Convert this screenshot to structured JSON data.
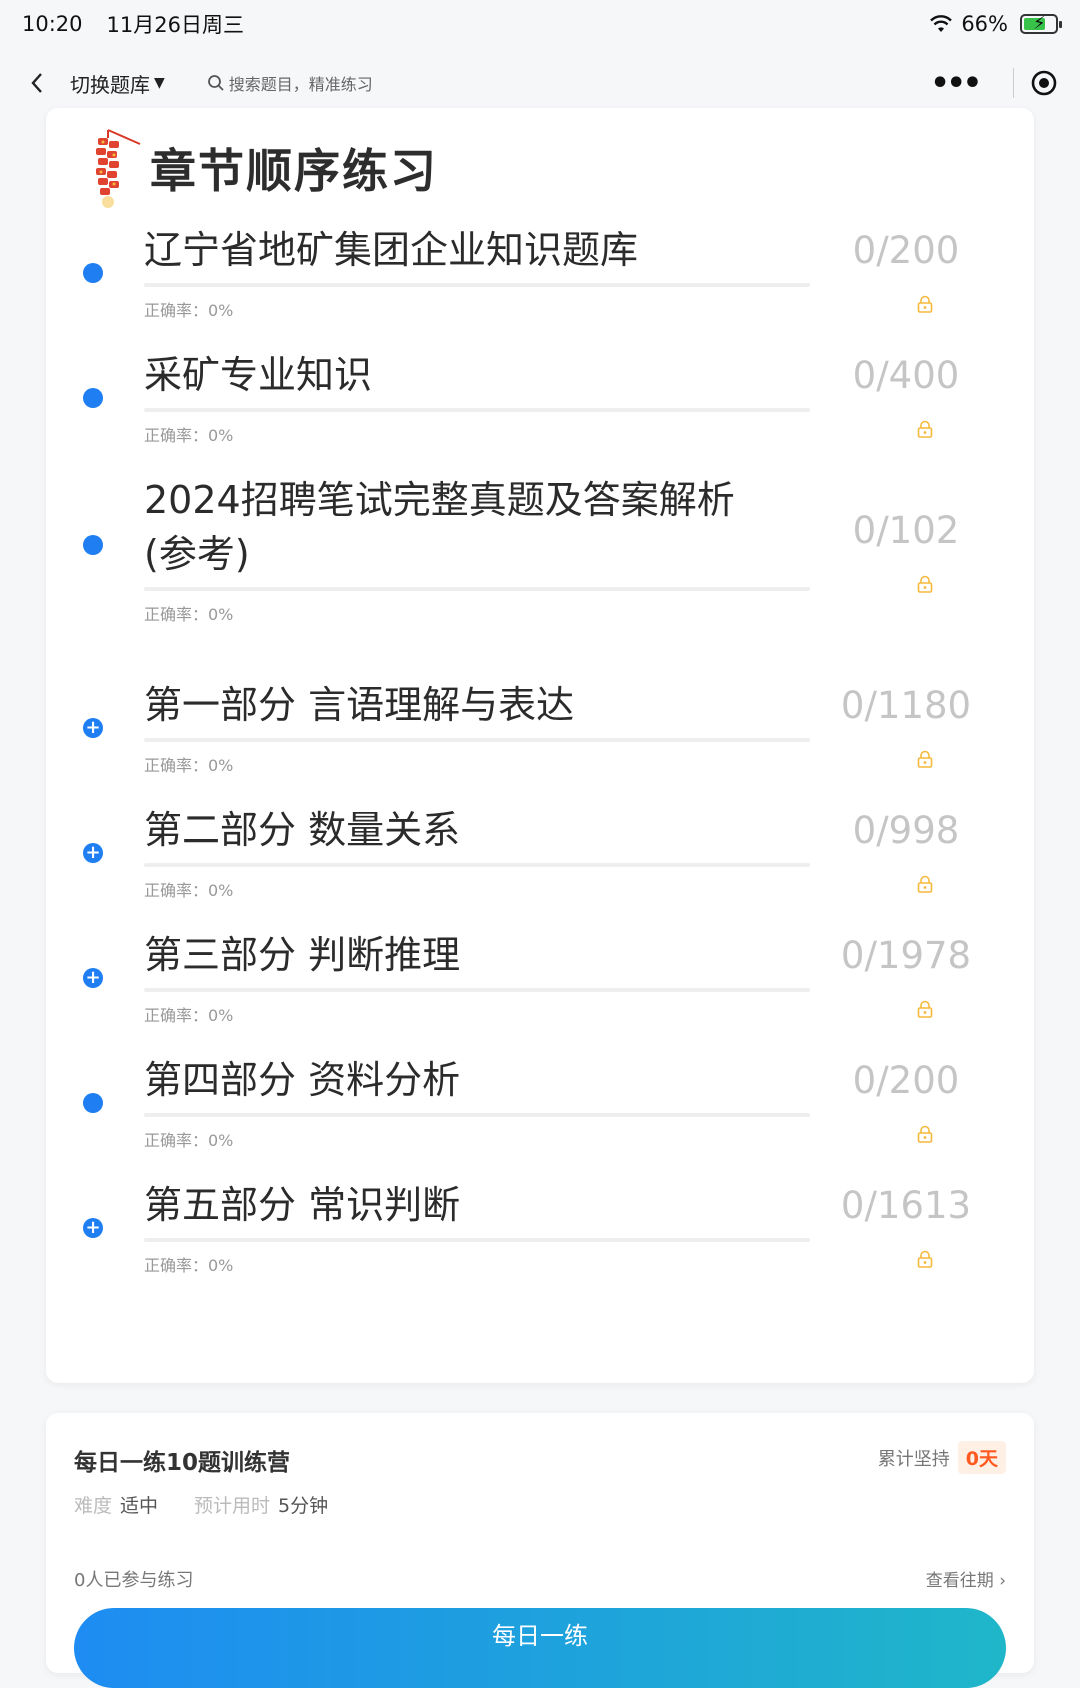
{
  "status_bar": {
    "time": "10:20",
    "date": "11月26日周三",
    "battery": "66%"
  },
  "nav": {
    "switch_bank": "切换题库",
    "search_placeholder": "搜索题目，精准练习"
  },
  "main_card": {
    "title": "章节顺序练习",
    "chapters": [
      {
        "name": "辽宁省地矿集团企业知识题库",
        "count": "0/200",
        "accuracy": "正确率：0%",
        "marker": "dot"
      },
      {
        "name": "采矿专业知识",
        "count": "0/400",
        "accuracy": "正确率：0%",
        "marker": "dot"
      },
      {
        "name": "2024招聘笔试完整真题及答案解析(参考)",
        "count": "0/102",
        "accuracy": "正确率：0%",
        "marker": "dot"
      },
      {
        "name": "第一部分 言语理解与表达",
        "count": "0/1180",
        "accuracy": "正确率：0%",
        "marker": "plus"
      },
      {
        "name": "第二部分 数量关系",
        "count": "0/998",
        "accuracy": "正确率：0%",
        "marker": "plus"
      },
      {
        "name": "第三部分 判断推理",
        "count": "0/1978",
        "accuracy": "正确率：0%",
        "marker": "plus"
      },
      {
        "name": "第四部分 资料分析",
        "count": "0/200",
        "accuracy": "正确率：0%",
        "marker": "dot"
      },
      {
        "name": "第五部分 常识判断",
        "count": "0/1613",
        "accuracy": "正确率：0%",
        "marker": "plus"
      }
    ]
  },
  "daily_card": {
    "title": "每日一练10题训练营",
    "streak_label": "累计坚持",
    "streak_value": "0天",
    "difficulty_label": "难度",
    "difficulty_value": "适中",
    "time_label": "预计用时",
    "time_value": "5分钟",
    "participants": "0人已参与练习",
    "history_link": "查看往期",
    "button": "每日一练"
  },
  "colors": {
    "accent": "#1e7ef2",
    "lock": "#f5b93b",
    "streak": "#ff5a1f"
  }
}
